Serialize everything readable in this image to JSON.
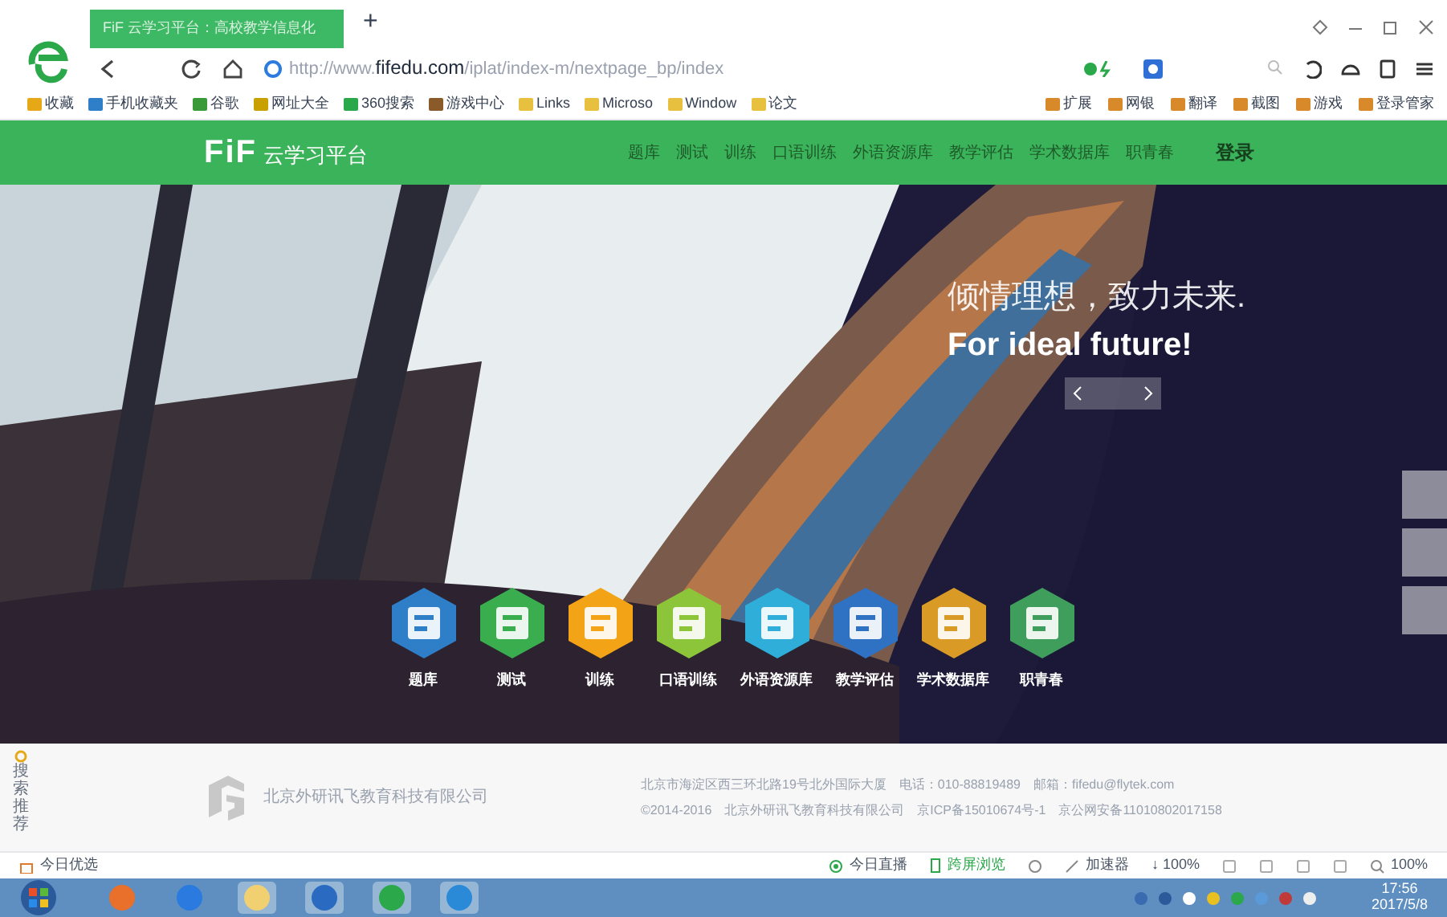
{
  "browser": {
    "new_tab": "+",
    "tab_title": "FiF 云学习平台：高校教学信息化",
    "url_host": "http://www.fifedu.com",
    "url_path": "/iplat/index-m/nextpage_bp/index",
    "bookmarks": [
      "收藏",
      "手机收藏夹",
      "谷歌",
      "网址大全",
      "360搜索",
      "游戏中心",
      "Links",
      "Microso",
      "Window",
      "论文"
    ],
    "extensions": [
      "扩展",
      "网银",
      "翻译",
      "截图",
      "游戏",
      "登录管家"
    ]
  },
  "site": {
    "logo": "FiF",
    "logo_text": "云学习平台",
    "nav": [
      "题库",
      "测试",
      "训练",
      "口语训练",
      "外语资源库",
      "教学评估",
      "学术数据库",
      "职青春"
    ],
    "login": "登录"
  },
  "hero": {
    "headline": "倾情理想，致力未来.",
    "tagline": "For ideal future!",
    "modules": [
      {
        "label": "题库",
        "color": "#2f7fc8"
      },
      {
        "label": "测试",
        "color": "#3aad4f"
      },
      {
        "label": "训练",
        "color": "#f2a316"
      },
      {
        "label": "口语训练",
        "color": "#8cc43a"
      },
      {
        "label": "外语资源库",
        "color": "#2eaed8"
      },
      {
        "label": "教学评估",
        "color": "#2f72c4"
      },
      {
        "label": "学术数据库",
        "color": "#d99a26"
      },
      {
        "label": "职青春",
        "color": "#3f9e5c"
      }
    ]
  },
  "footer": {
    "side_label": "搜索推荐",
    "company": "北京外研讯飞教育科技有限公司",
    "address": "北京市海淀区西三环北路19号北外国际大厦　电话：010-88819489　邮箱：fifedu@flytek.com",
    "copyright": "©2014-2016　北京外研讯飞教育科技有限公司　京ICP备15010674号-1　京公网安备11010802017158"
  },
  "status_bar": {
    "left": "今日优选",
    "live": "今日直播",
    "cross_screen": "跨屏浏览",
    "accelerator": "加速器",
    "download": "↓ 100%",
    "zoom": "100%"
  },
  "taskbar": {
    "time": "17:56",
    "date": "2017/5/8"
  }
}
